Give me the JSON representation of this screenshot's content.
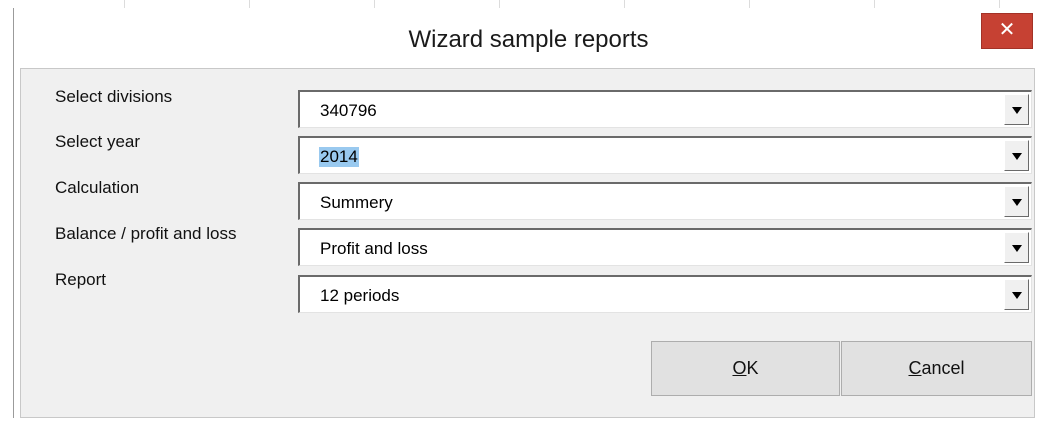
{
  "dialog": {
    "title": "Wizard sample reports",
    "close_glyph": "✕"
  },
  "fields": [
    {
      "label": "Select divisions",
      "value": "340796"
    },
    {
      "label": "Select year",
      "value": "2014"
    },
    {
      "label": "Calculation",
      "value": "Summery"
    },
    {
      "label": "Balance / profit and loss",
      "value": "Profit and loss"
    },
    {
      "label": "Report",
      "value": "12 periods"
    }
  ],
  "buttons": {
    "ok": {
      "accel": "O",
      "rest": "K"
    },
    "cancel": {
      "accel": "C",
      "rest": "ancel"
    }
  },
  "colors": {
    "close_button": "#c64133",
    "dialog_background": "#f0f0f0",
    "selection_highlight": "#99c9ef"
  },
  "icons": {
    "close": "close-icon",
    "dropdown": "chevron-down-icon"
  }
}
